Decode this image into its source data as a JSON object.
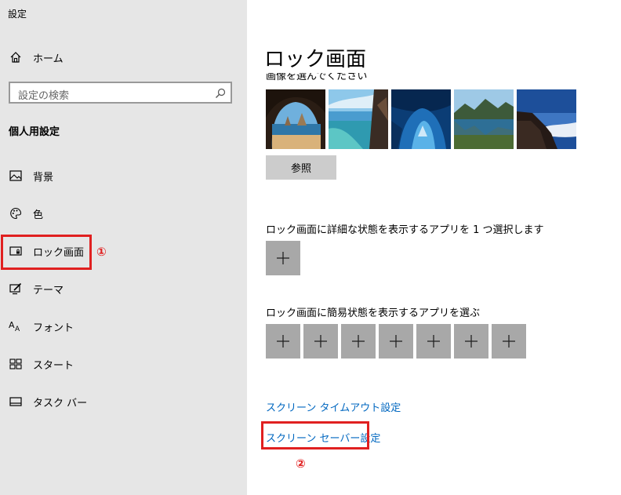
{
  "window": {
    "title": "設定"
  },
  "sidebar": {
    "home_label": "ホーム",
    "search_placeholder": "設定の検索",
    "section_title": "個人用設定",
    "items": [
      {
        "label": "背景",
        "icon": "picture-icon"
      },
      {
        "label": "色",
        "icon": "palette-icon"
      },
      {
        "label": "ロック画面",
        "icon": "lock-screen-icon"
      },
      {
        "label": "テーマ",
        "icon": "theme-icon"
      },
      {
        "label": "フォント",
        "icon": "font-icon"
      },
      {
        "label": "スタート",
        "icon": "start-icon"
      },
      {
        "label": "タスク バー",
        "icon": "taskbar-icon"
      }
    ]
  },
  "annotations": {
    "one": "①",
    "two": "②",
    "color": "#e02020"
  },
  "main": {
    "title": "ロック画面",
    "partial_label": "画像を選んでください",
    "thumbnails": [
      "cave-beach",
      "ocean-coast",
      "ice-cave",
      "mountain-lake",
      "sea-of-clouds"
    ],
    "browse_button": "参照",
    "detailed_status_label": "ロック画面に詳細な状態を表示するアプリを 1 つ選択します",
    "quick_status_label": "ロック画面に簡易状態を表示するアプリを選ぶ",
    "quick_status_count": 7,
    "screen_timeout_link": "スクリーン タイムアウト設定",
    "screensaver_link": "スクリーン セーバー設定"
  },
  "colors": {
    "link": "#0067c0",
    "sidebar_bg": "#e6e6e6",
    "plus_bg": "#a8a8a8"
  }
}
